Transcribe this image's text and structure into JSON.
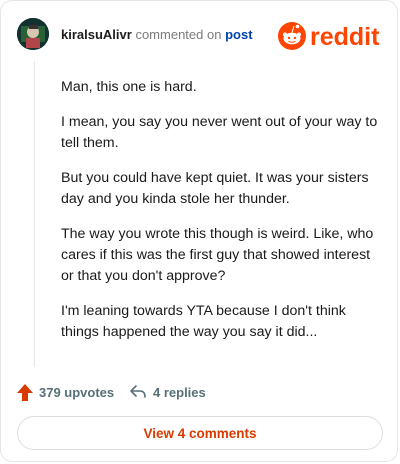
{
  "header": {
    "username": "kiralsuAlivr",
    "action_text": "commented on",
    "post_link": "post",
    "brand": "reddit"
  },
  "comment": {
    "paragraphs": [
      "Man, this one is hard.",
      "I mean, you say you never went out of your way to tell them.",
      "But you could have kept quiet. It was your sisters day and you kinda stole her thunder.",
      "The way you wrote this though is weird. Like, who cares if this was the first guy that showed interest or that you don't approve?",
      "I'm leaning towards YTA because I don't think things happened the way you say it did..."
    ]
  },
  "actions": {
    "upvotes": "379 upvotes",
    "replies": "4 replies"
  },
  "footer": {
    "view_button": "View 4 comments"
  },
  "colors": {
    "accent": "#d93a00",
    "brand": "#ff4500",
    "link": "#0045ac"
  },
  "icons": {
    "upvote": "upvote-arrow-icon",
    "reply": "reply-arrow-icon",
    "logo": "reddit-snoo-icon"
  }
}
